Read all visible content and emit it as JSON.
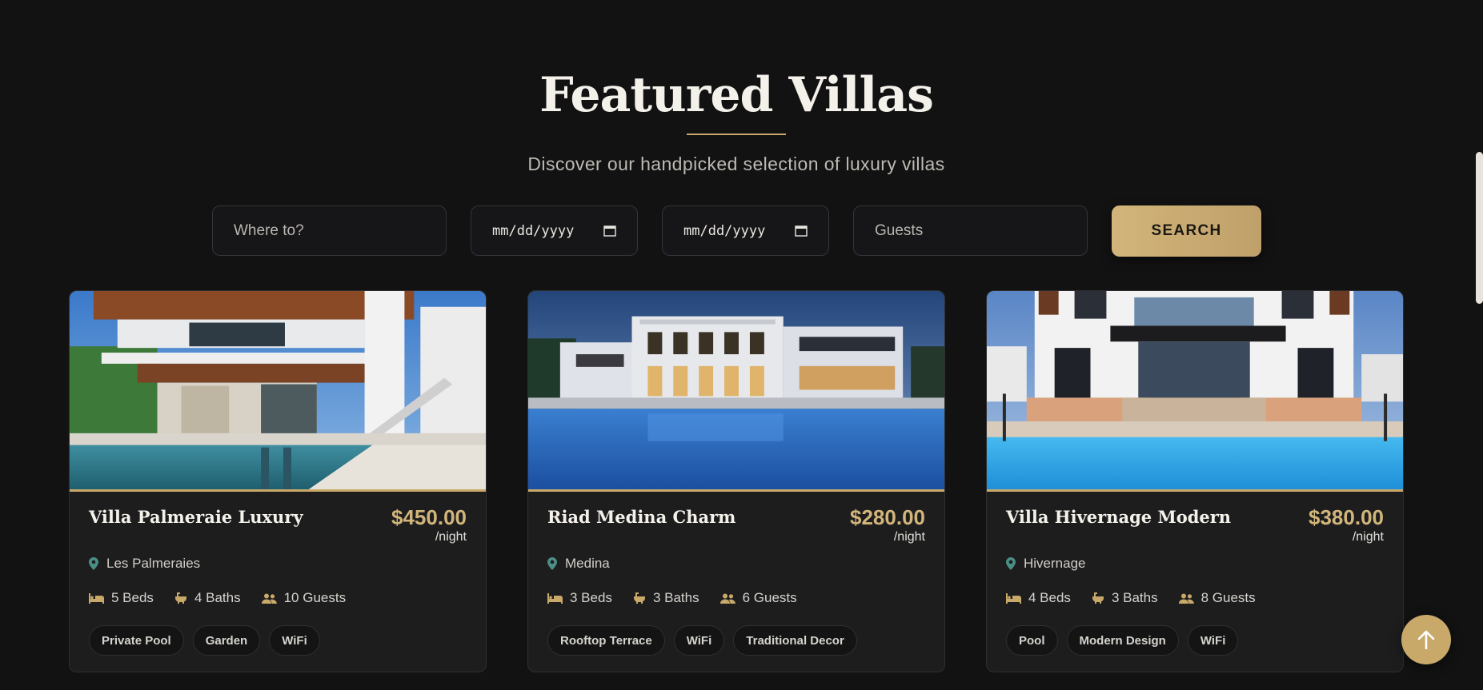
{
  "header": {
    "title": "Featured Villas",
    "subtitle": "Discover our handpicked selection of luxury villas"
  },
  "search": {
    "destination_placeholder": "Where to?",
    "checkin_value": "mm/dd/yyyy",
    "checkout_value": "mm/dd/yyyy",
    "guests_placeholder": "Guests",
    "button_label": "SEARCH"
  },
  "villas": [
    {
      "name": "Villa Palmeraie Luxury",
      "price": "$450.00",
      "per": "/night",
      "location": "Les Palmeraies",
      "beds": "5 Beds",
      "baths": "4 Baths",
      "guests": "10 Guests",
      "tags": [
        "Private Pool",
        "Garden",
        "WiFi"
      ]
    },
    {
      "name": "Riad Medina Charm",
      "price": "$280.00",
      "per": "/night",
      "location": "Medina",
      "beds": "3 Beds",
      "baths": "3 Baths",
      "guests": "6 Guests",
      "tags": [
        "Rooftop Terrace",
        "WiFi",
        "Traditional Decor"
      ]
    },
    {
      "name": "Villa Hivernage Modern",
      "price": "$380.00",
      "per": "/night",
      "location": "Hivernage",
      "beds": "4 Beds",
      "baths": "3 Baths",
      "guests": "8 Guests",
      "tags": [
        "Pool",
        "Modern Design",
        "WiFi"
      ]
    }
  ],
  "colors": {
    "background": "#121213",
    "card": "#1d1d1e",
    "accent_gold": "#c9a96a",
    "location_pin": "#4a8f86"
  },
  "icons": {
    "location": "map-pin-icon",
    "beds": "bed-icon",
    "baths": "bathtub-icon",
    "guests": "users-icon",
    "calendar": "calendar-icon",
    "scroll_top": "arrow-up-icon"
  }
}
